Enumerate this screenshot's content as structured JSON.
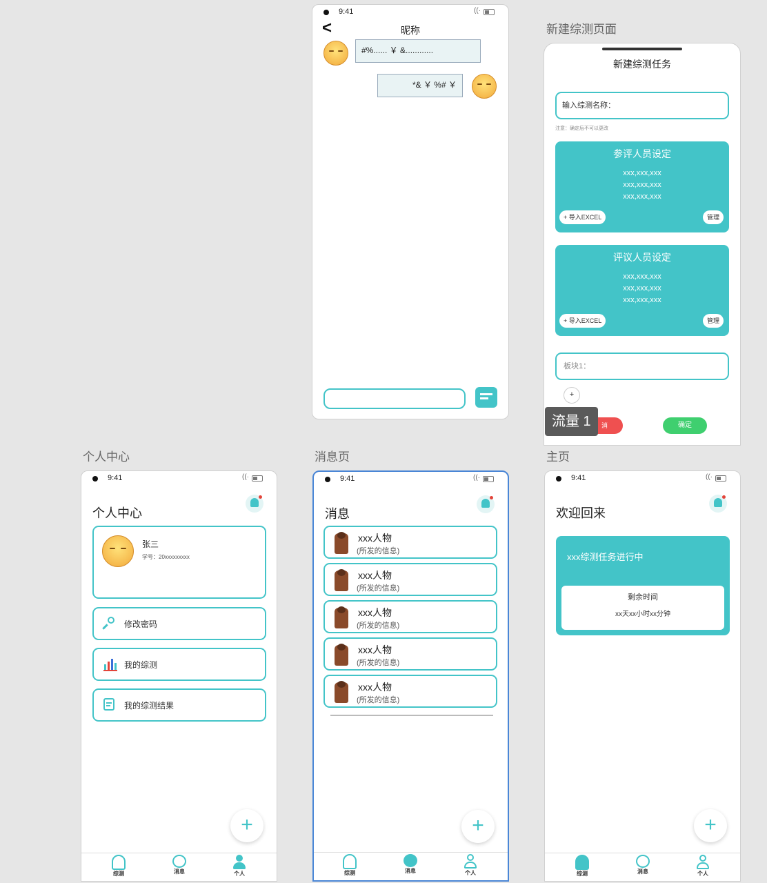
{
  "status": {
    "time": "9:41",
    "wifi": "((·",
    "battery": ""
  },
  "frames": {
    "profile": "个人中心",
    "messages": "消息页",
    "home": "主页",
    "new_test": "新建综测页面"
  },
  "chat": {
    "title": "昵称",
    "back": "<",
    "incoming": "#%...... ￥ &............",
    "outgoing": "*& ￥ %# ￥",
    "input_placeholder": ""
  },
  "new_test": {
    "header": "新建综测任务",
    "name_placeholder": "输入综测名称：",
    "name_note": "注意：确定后不可以更改",
    "reviewee": {
      "title": "参评人员设定",
      "lines": [
        "xxx,xxx,xxx",
        "xxx,xxx,xxx",
        "xxx,xxx,xxx"
      ],
      "import": "+ 导入EXCEL",
      "manage": "管理"
    },
    "reviewer": {
      "title": "评议人员设定",
      "lines": [
        "xxx,xxx,xxx",
        "xxx,xxx,xxx",
        "xxx,xxx,xxx"
      ],
      "import": "+ 导入EXCEL",
      "manage": "管理"
    },
    "block": "板块1：",
    "add": "+",
    "cancel": "消",
    "confirm": "确定",
    "flow": "流量 1"
  },
  "profile": {
    "title": "个人中心",
    "name": "张三",
    "student_id": "学号：20xxxxxxxxx",
    "menu": [
      "修改密码",
      "我的综测",
      "我的综测结果"
    ]
  },
  "messages": {
    "title": "消息",
    "items": [
      {
        "name": "xxx人物",
        "sub": "(所发的信息)"
      },
      {
        "name": "xxx人物",
        "sub": "(所发的信息)"
      },
      {
        "name": "xxx人物",
        "sub": "(所发的信息)"
      },
      {
        "name": "xxx人物",
        "sub": "(所发的信息)"
      },
      {
        "name": "xxx人物",
        "sub": "(所发的信息)"
      }
    ]
  },
  "home": {
    "title": "欢迎回来",
    "task": "xxx综测任务进行中",
    "remain_label": "剩余时间",
    "remain_value": "xx天xx小时xx分钟"
  },
  "tabs": {
    "home": "综测",
    "messages": "消息",
    "me": "个人"
  },
  "fab": "+",
  "colors": {
    "accent": "#43c4c8",
    "danger": "#ef5050",
    "ok": "#3fcf6f"
  }
}
